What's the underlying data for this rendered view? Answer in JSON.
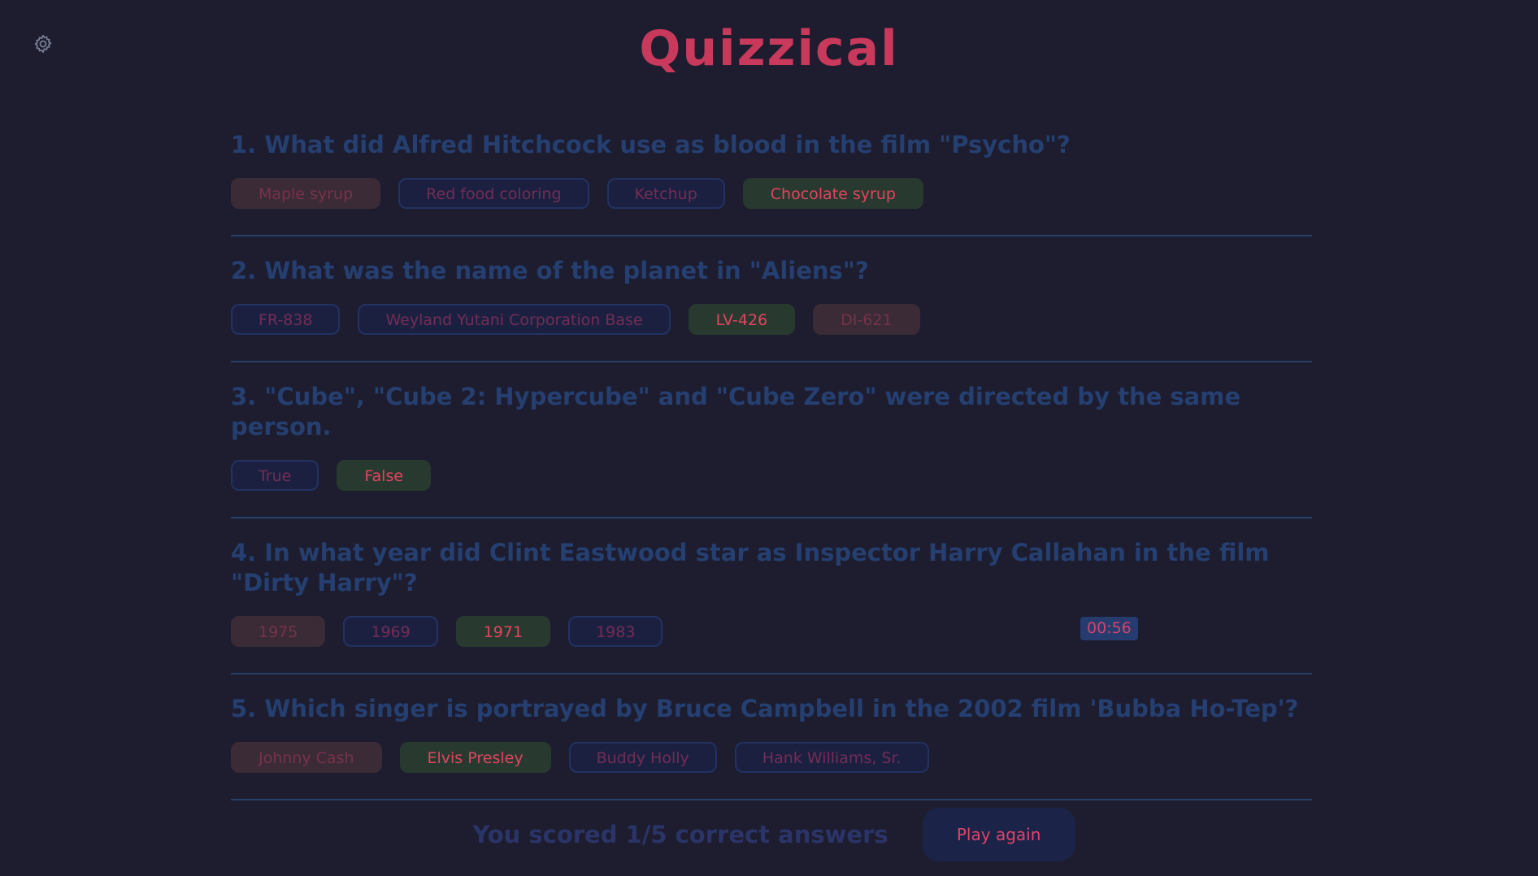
{
  "header": {
    "title": "Quizzical",
    "settings_icon": "gear-icon"
  },
  "questions": [
    {
      "text": "1. What did Alfred Hitchcock use as blood in the film \"Psycho\"?",
      "answers": [
        {
          "label": "Maple syrup",
          "state": "wrong"
        },
        {
          "label": "Red food coloring",
          "state": "neutral"
        },
        {
          "label": "Ketchup",
          "state": "neutral"
        },
        {
          "label": "Chocolate syrup",
          "state": "correct"
        }
      ]
    },
    {
      "text": "2. What was the name of the planet in \"Aliens\"?",
      "answers": [
        {
          "label": "FR-838",
          "state": "neutral"
        },
        {
          "label": "Weyland Yutani Corporation Base",
          "state": "neutral"
        },
        {
          "label": "LV-426",
          "state": "correct"
        },
        {
          "label": "DI-621",
          "state": "wrong"
        }
      ]
    },
    {
      "text": "3. \"Cube\", \"Cube 2: Hypercube\" and \"Cube Zero\" were directed by the same person.",
      "answers": [
        {
          "label": "True",
          "state": "neutral"
        },
        {
          "label": "False",
          "state": "correct"
        }
      ]
    },
    {
      "text": "4. In what year did Clint Eastwood star as Inspector Harry Callahan in the film \"Dirty Harry\"?",
      "answers": [
        {
          "label": "1975",
          "state": "wrong"
        },
        {
          "label": "1969",
          "state": "neutral"
        },
        {
          "label": "1971",
          "state": "correct"
        },
        {
          "label": "1983",
          "state": "neutral"
        }
      ]
    },
    {
      "text": "5. Which singer is portrayed by Bruce Campbell in the 2002 film 'Bubba Ho-Tep'?",
      "answers": [
        {
          "label": "Johnny Cash",
          "state": "wrong"
        },
        {
          "label": "Elvis Presley",
          "state": "correct"
        },
        {
          "label": "Buddy Holly",
          "state": "neutral"
        },
        {
          "label": "Hank Williams, Sr.",
          "state": "neutral"
        }
      ]
    }
  ],
  "timer": "00:56",
  "footer": {
    "score_text": "You scored 1/5 correct answers",
    "play_again_label": "Play again"
  },
  "colors": {
    "background": "#1d1d2f",
    "title": "#c9395b",
    "question_text": "#253f71",
    "correct_answer": "#283a2f",
    "wrong_answer": "#3a2b37",
    "divider": "#27406a"
  }
}
